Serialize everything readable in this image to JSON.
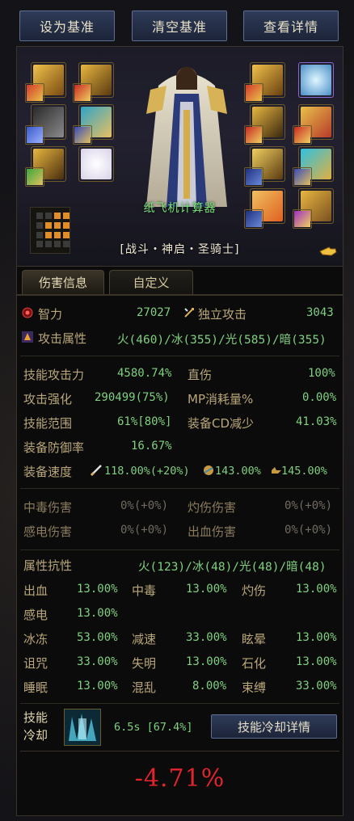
{
  "toolbar": {
    "set_baseline": "设为基准",
    "clear_baseline": "清空基准",
    "view_details": "查看详情"
  },
  "character": {
    "name": "纸飞机计算器",
    "class": "[战斗・神启・圣骑士]"
  },
  "tabs": [
    {
      "label": "伤害信息"
    },
    {
      "label": "自定义"
    }
  ],
  "primary": {
    "int_label": "智力",
    "int_value": "27027",
    "indep_label": "独立攻击",
    "indep_value": "3043",
    "elem_label": "攻击属性",
    "elem_value": "火(460)/冰(355)/光(585)/暗(355)"
  },
  "stats": {
    "skill_atk_label": "技能攻击力",
    "skill_atk_value": "4580.74%",
    "direct_label": "直伤",
    "direct_value": "100%",
    "atk_boost_label": "攻击强化",
    "atk_boost_value": "290499(75%)",
    "mp_label": "MP消耗量%",
    "mp_value": "0.00%",
    "range_label": "技能范围",
    "range_value": "61%[80%]",
    "cdr_label": "装备CD减少",
    "cdr_value": "41.03%",
    "def_label": "装备防御率",
    "def_value": "16.67%",
    "speed_label": "装备速度",
    "atk_speed": "118.00%(+20%)",
    "cast_speed": "143.00%",
    "move_speed": "145.00%"
  },
  "dot": {
    "poison_label": "中毒伤害",
    "poison_value": "0%(+0%)",
    "burn_label": "灼伤伤害",
    "burn_value": "0%(+0%)",
    "shock_label": "感电伤害",
    "shock_value": "0%(+0%)",
    "bleed_label": "出血伤害",
    "bleed_value": "0%(+0%)"
  },
  "resist": {
    "title": "属性抗性",
    "elem": "火(123)/冰(48)/光(48)/暗(48)",
    "bleed_label": "出血",
    "bleed": "13.00%",
    "poison_label": "中毒",
    "poison": "13.00%",
    "burn_label": "灼伤",
    "burn": "13.00%",
    "shock_label": "感电",
    "shock": "13.00%",
    "freeze_label": "冰冻",
    "freeze": "53.00%",
    "slow_label": "减速",
    "slow": "33.00%",
    "stun_label": "眩晕",
    "stun": "13.00%",
    "curse_label": "诅咒",
    "curse": "33.00%",
    "blind_label": "失明",
    "blind": "13.00%",
    "stone_label": "石化",
    "stone": "13.00%",
    "sleep_label": "睡眠",
    "sleep": "13.00%",
    "confuse_label": "混乱",
    "confuse": "8.00%",
    "bind_label": "束缚",
    "bind": "33.00%"
  },
  "skill_cd": {
    "label_line1": "技能",
    "label_line2": "冷却",
    "value": "6.5s [67.4%]",
    "button": "技能冷却详情"
  },
  "total_change": "-4.71%",
  "colors": {
    "positive": "#7fd07f",
    "negative": "#e3242b",
    "label": "#b9a77a",
    "button": "#243050"
  }
}
